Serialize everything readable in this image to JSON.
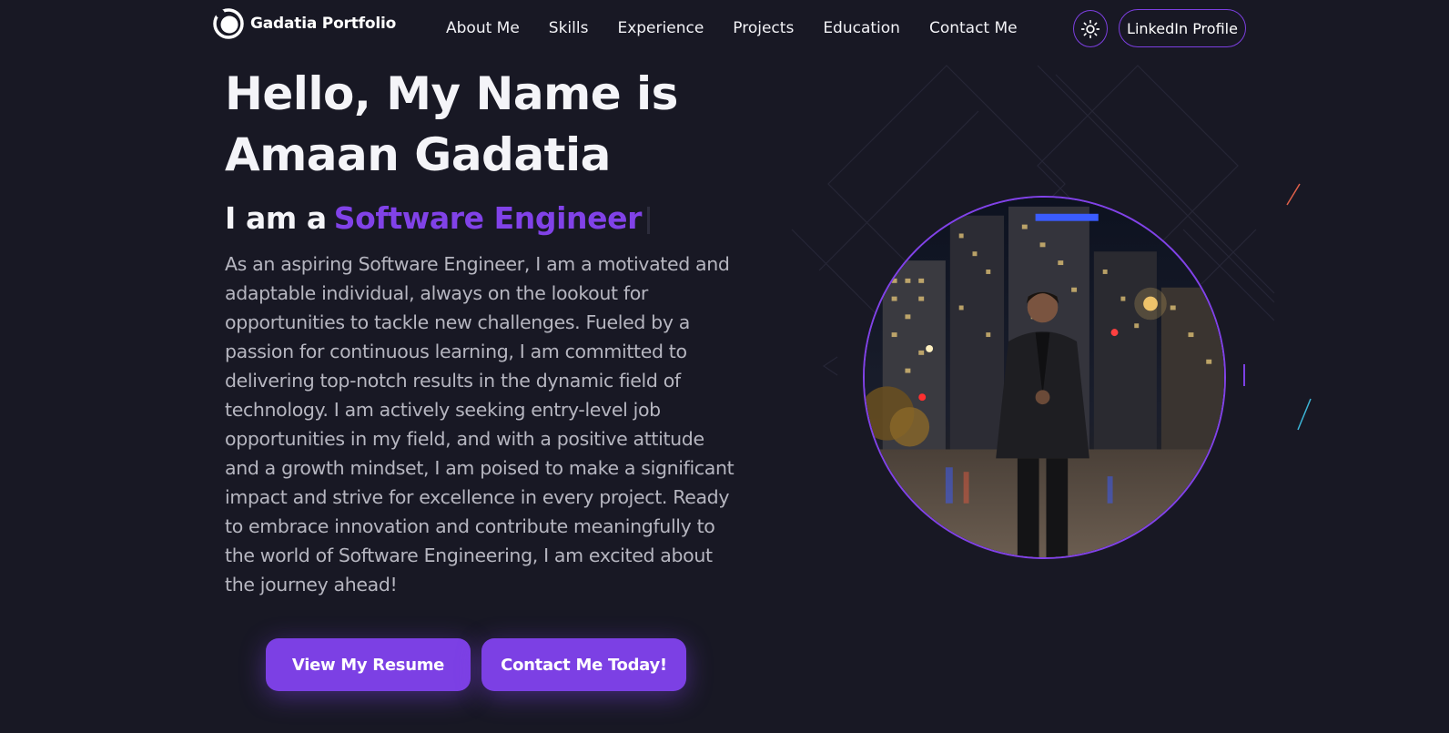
{
  "brand": {
    "name": "Gadatia Portfolio"
  },
  "nav": {
    "links": [
      "About Me",
      "Skills",
      "Experience",
      "Projects",
      "Education",
      "Contact Me"
    ],
    "theme_toggle_icon": "sun-icon",
    "linkedin_label": "LinkedIn Profile"
  },
  "hero": {
    "title_line1": "Hello, My Name is",
    "title_line2": "Amaan Gadatia",
    "role_prefix": "I am a",
    "role_typed": "Software Engineer",
    "intro": "As an aspiring Software Engineer, I am a motivated and adaptable individual, always on the lookout for opportunities to tackle new challenges. Fueled by a passion for continuous learning, I am committed to delivering top-notch results in the dynamic field of technology. I am actively seeking entry-level job opportunities in my field, and with a positive attitude and a growth mindset, I am poised to make a significant impact and strive for excellence in every project. Ready to embrace innovation and contribute meaningfully to the world of Software Engineering, I am excited about the journey ahead!",
    "resume_button": "View My Resume",
    "contact_button": "Contact Me Today!"
  },
  "colors": {
    "background": "#181824",
    "accent": "#7c40e4",
    "text": "#f4f4f8",
    "muted_text": "#b6b6c0"
  }
}
